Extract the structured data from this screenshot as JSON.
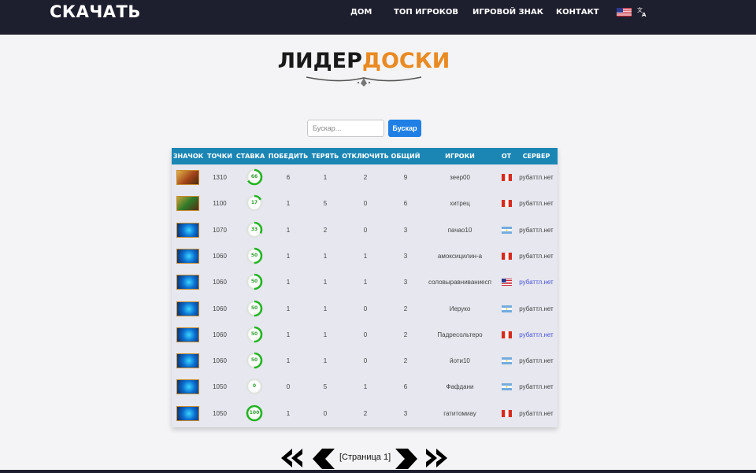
{
  "header": {
    "logo": "СКАЧАТЬ",
    "nav": [
      "ДОМ",
      "ТОП ИГРОКОВ",
      "ИГРОВОЙ ЗНАК",
      "КОНТАКТ"
    ],
    "language_flag_icon": "us-flag-icon",
    "translate_icon": "translate-icon"
  },
  "title": {
    "part1": "ЛИДЕР",
    "part2": "ДОСКИ",
    "accent_color": "#e98a22"
  },
  "search": {
    "placeholder": "Бускар...",
    "value": "",
    "button_label": "Бускар"
  },
  "table": {
    "headers": [
      "ЗНАЧОК",
      "ТОЧКИ",
      "СТАВКА",
      "ПОБЕДИТЬ",
      "ТЕРЯТЬ",
      "ОТКЛЮЧИТЬ",
      "ОБЩИЙ",
      "ИГРОКИ",
      "ОТ",
      "СЕРВЕР"
    ],
    "header_color": "#1b86b4",
    "gauge_color": "#22b422",
    "rows": [
      {
        "badge": "gold",
        "points": "1310",
        "rate": 66,
        "wins": "6",
        "losses": "1",
        "disconnects": "2",
        "total": "9",
        "player": "зеер00",
        "from": "peru-flag-icon",
        "server": "рубаттл.нет",
        "server_link": false
      },
      {
        "badge": "green",
        "points": "1100",
        "rate": 17,
        "wins": "1",
        "losses": "5",
        "disconnects": "0",
        "total": "6",
        "player": "хитрец",
        "from": "peru-flag-icon",
        "server": "рубаттл.нет",
        "server_link": false
      },
      {
        "badge": "blue",
        "points": "1070",
        "rate": 33,
        "wins": "1",
        "losses": "2",
        "disconnects": "0",
        "total": "3",
        "player": "пачао10",
        "from": "argentina-flag-icon",
        "server": "рубаттл.нет",
        "server_link": false
      },
      {
        "badge": "blue",
        "points": "1060",
        "rate": 50,
        "wins": "1",
        "losses": "1",
        "disconnects": "1",
        "total": "3",
        "player": "амоксицилин-а",
        "from": "peru-flag-icon",
        "server": "рубаттл.нет",
        "server_link": false
      },
      {
        "badge": "blue",
        "points": "1060",
        "rate": 50,
        "wins": "1",
        "losses": "1",
        "disconnects": "1",
        "total": "3",
        "player": "соловыравниваниесп",
        "from": "us-flag-icon",
        "server": "рубаттл.нет",
        "server_link": true
      },
      {
        "badge": "blue",
        "points": "1060",
        "rate": 50,
        "wins": "1",
        "losses": "1",
        "disconnects": "0",
        "total": "2",
        "player": "Иеруко",
        "from": "argentina-flag-icon",
        "server": "рубаттл.нет",
        "server_link": false
      },
      {
        "badge": "blue",
        "points": "1060",
        "rate": 50,
        "wins": "1",
        "losses": "1",
        "disconnects": "0",
        "total": "2",
        "player": "Падресольтеро",
        "from": "peru-flag-icon",
        "server": "рубаттл.нет",
        "server_link": true
      },
      {
        "badge": "blue",
        "points": "1060",
        "rate": 50,
        "wins": "1",
        "losses": "1",
        "disconnects": "0",
        "total": "2",
        "player": "йоти10",
        "from": "argentina-flag-icon",
        "server": "рубаттл.нет",
        "server_link": false
      },
      {
        "badge": "blue",
        "points": "1050",
        "rate": 0,
        "wins": "0",
        "losses": "5",
        "disconnects": "1",
        "total": "6",
        "player": "Фафдани",
        "from": "argentina-flag-icon",
        "server": "рубаттл.нет",
        "server_link": false
      },
      {
        "badge": "blue",
        "points": "1050",
        "rate": 100,
        "wins": "1",
        "losses": "0",
        "disconnects": "2",
        "total": "3",
        "player": "гатитомиау",
        "from": "peru-flag-icon",
        "server": "рубаттл.нет",
        "server_link": false
      }
    ]
  },
  "pagination": {
    "label": "[Страница 1]",
    "icons": [
      "first-page-icon",
      "previous-page-icon",
      "next-page-icon",
      "last-page-icon"
    ]
  }
}
